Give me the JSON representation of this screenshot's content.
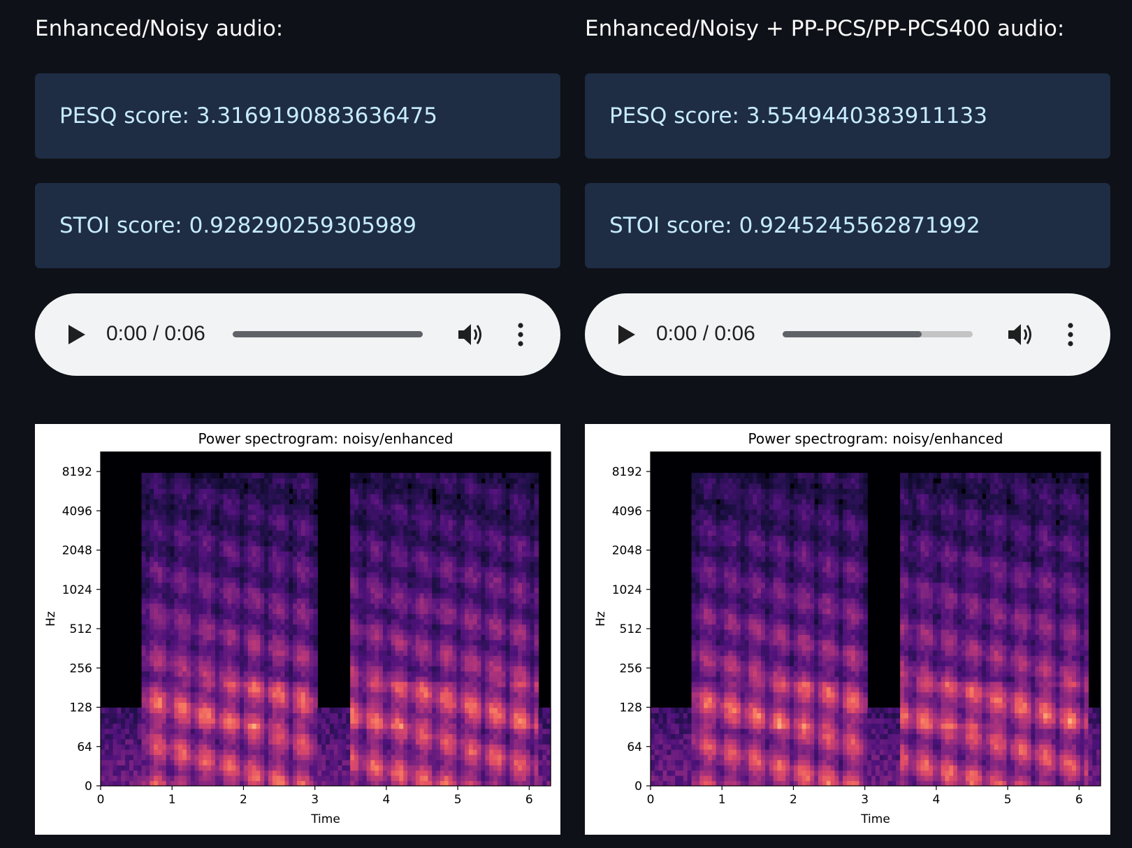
{
  "columns": [
    {
      "heading": "Enhanced/Noisy audio:",
      "pesq": "PESQ score: 3.3169190883636475",
      "stoi": "STOI score: 0.928290259305989",
      "audio": {
        "time": "0:00 / 0:06",
        "progress": 1.0
      }
    },
    {
      "heading": "Enhanced/Noisy + PP-PCS/PP-PCS400 audio:",
      "pesq": "PESQ score: 3.5549440383911133",
      "stoi": "STOI score: 0.9245245562871992",
      "audio": {
        "time": "0:00 / 0:06",
        "progress": 0.73
      }
    }
  ],
  "icons": [
    "play-icon",
    "volume-icon",
    "more-vert-icon"
  ],
  "colors": {
    "background": "#0e1117",
    "info_box": "#1e2d44",
    "info_text": "#c7ebff",
    "player": "#f1f3f4"
  },
  "chart_data": [
    {
      "type": "heatmap",
      "title": "Power spectrogram: noisy/enhanced",
      "xlabel": "Time",
      "ylabel": "Hz",
      "x_ticks": [
        0,
        1,
        2,
        3,
        4,
        5,
        6
      ],
      "y_ticks": [
        0,
        64,
        128,
        256,
        512,
        1024,
        2048,
        4096,
        8192
      ],
      "xlim": [
        0,
        6.3
      ],
      "y_scale": "symlog",
      "colormap": "magma",
      "speech_segments": [
        [
          0.6,
          3.05
        ],
        [
          3.5,
          6.1
        ]
      ]
    },
    {
      "type": "heatmap",
      "title": "Power spectrogram: noisy/enhanced",
      "xlabel": "Time",
      "ylabel": "Hz",
      "x_ticks": [
        0,
        1,
        2,
        3,
        4,
        5,
        6
      ],
      "y_ticks": [
        0,
        64,
        128,
        256,
        512,
        1024,
        2048,
        4096,
        8192
      ],
      "xlim": [
        0,
        6.3
      ],
      "y_scale": "symlog",
      "colormap": "magma",
      "speech_segments": [
        [
          0.6,
          3.05
        ],
        [
          3.5,
          6.1
        ]
      ]
    }
  ]
}
